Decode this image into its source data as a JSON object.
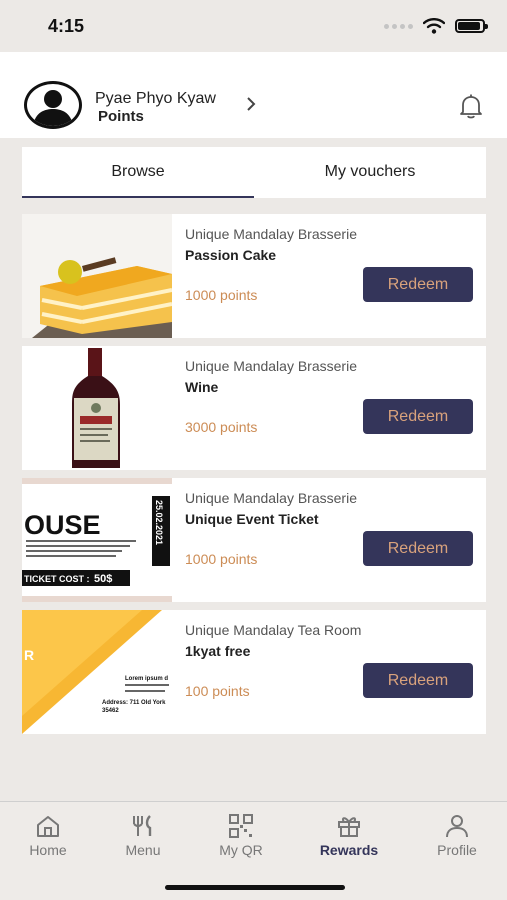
{
  "status_bar": {
    "time": "4:15"
  },
  "header": {
    "user_name": "Pyae Phyo Kyaw",
    "points_label": "Points"
  },
  "tabs": [
    {
      "label": "Browse",
      "active": true
    },
    {
      "label": "My vouchers",
      "active": false
    }
  ],
  "rewards": [
    {
      "merchant": "Unique Mandalay Brasserie",
      "title": "Passion Cake",
      "points": "1000 points",
      "button": "Redeem",
      "image": "cake"
    },
    {
      "merchant": "Unique Mandalay Brasserie",
      "title": "Wine",
      "points": "3000 points",
      "button": "Redeem",
      "image": "wine-bottle"
    },
    {
      "merchant": "Unique Mandalay Brasserie",
      "title": "Unique Event Ticket",
      "points": "1000 points",
      "button": "Redeem",
      "image": "event-ticket",
      "image_text": {
        "headline": "OUSE",
        "date": "25.02.2021",
        "ticket_cost_label": "TICKET COST :",
        "ticket_cost_value": "50$"
      }
    },
    {
      "merchant": "Unique Mandalay Tea Room",
      "title": "1kyat free",
      "points": "100 points",
      "button": "Redeem",
      "image": "tea-room-flyer",
      "image_text": {
        "line1": "Lorem ipsum d",
        "line2": "Address: 711 Old York",
        "line3": "35462"
      }
    }
  ],
  "tabbar": [
    {
      "label": "Home",
      "icon": "home-icon",
      "active": false
    },
    {
      "label": "Menu",
      "icon": "fork-knife-icon",
      "active": false
    },
    {
      "label": "My QR",
      "icon": "qr-icon",
      "active": false
    },
    {
      "label": "Rewards",
      "icon": "gift-icon",
      "active": true
    },
    {
      "label": "Profile",
      "icon": "person-icon",
      "active": false
    }
  ],
  "colors": {
    "accent": "#34355a",
    "points": "#cc8c55",
    "button_text": "#d9a27c",
    "background": "#ece9e6"
  }
}
